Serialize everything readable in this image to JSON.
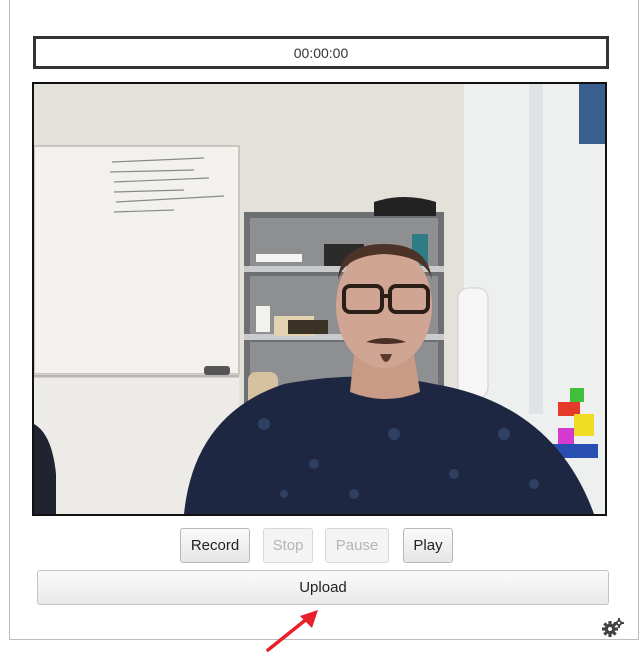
{
  "recorder": {
    "timer": "00:00:00",
    "buttons": {
      "record": "Record",
      "stop": "Stop",
      "pause": "Pause",
      "play": "Play"
    },
    "upload": "Upload",
    "stop_enabled": false,
    "pause_enabled": false
  },
  "icons": {
    "settings": "gear-icon",
    "annotation": "red-arrow-icon"
  },
  "colors": {
    "arrow": "#e8202a",
    "timer_border": "#333333"
  }
}
